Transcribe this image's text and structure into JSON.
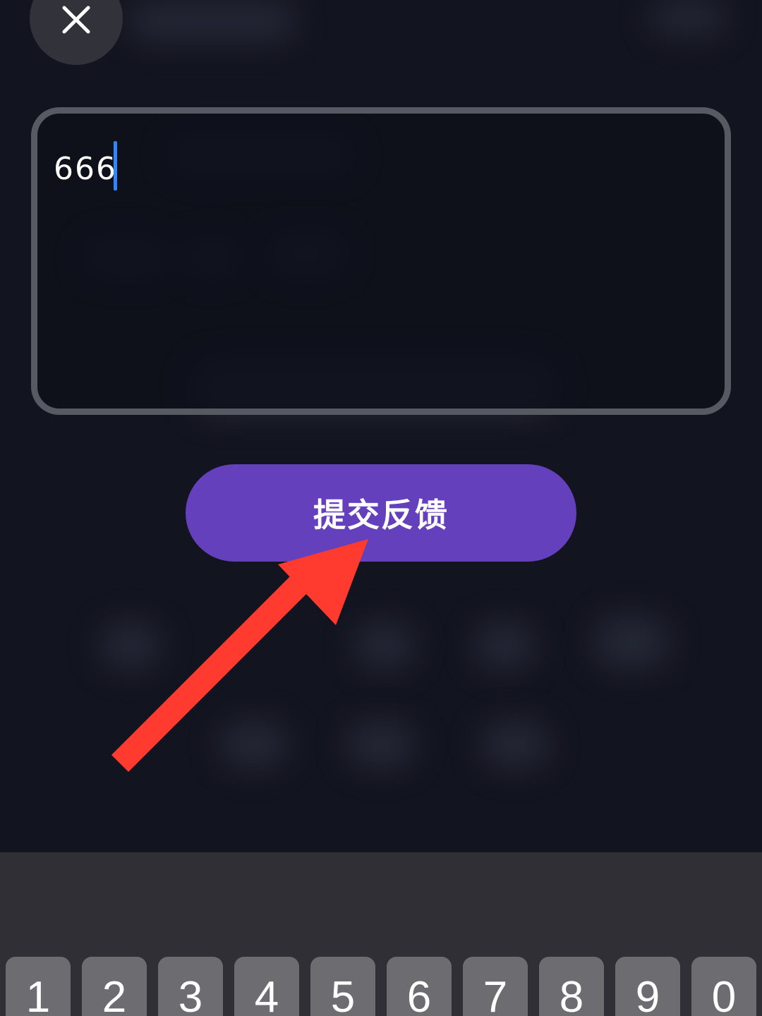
{
  "feedback": {
    "input_value": "666"
  },
  "submit": {
    "label": "提交反馈"
  },
  "keyboard": {
    "number_row": [
      "1",
      "2",
      "3",
      "4",
      "5",
      "6",
      "7",
      "8",
      "9",
      "0"
    ]
  },
  "icons": {
    "close": "close-icon",
    "annotation": "red-arrow-annotation"
  },
  "colors": {
    "background": "#12141f",
    "accent_button": "#6440bd",
    "caret": "#2f87ff",
    "annotation_arrow": "#ff3b30",
    "keyboard_bg": "#2f2f35",
    "key_bg": "#6c6c71"
  }
}
